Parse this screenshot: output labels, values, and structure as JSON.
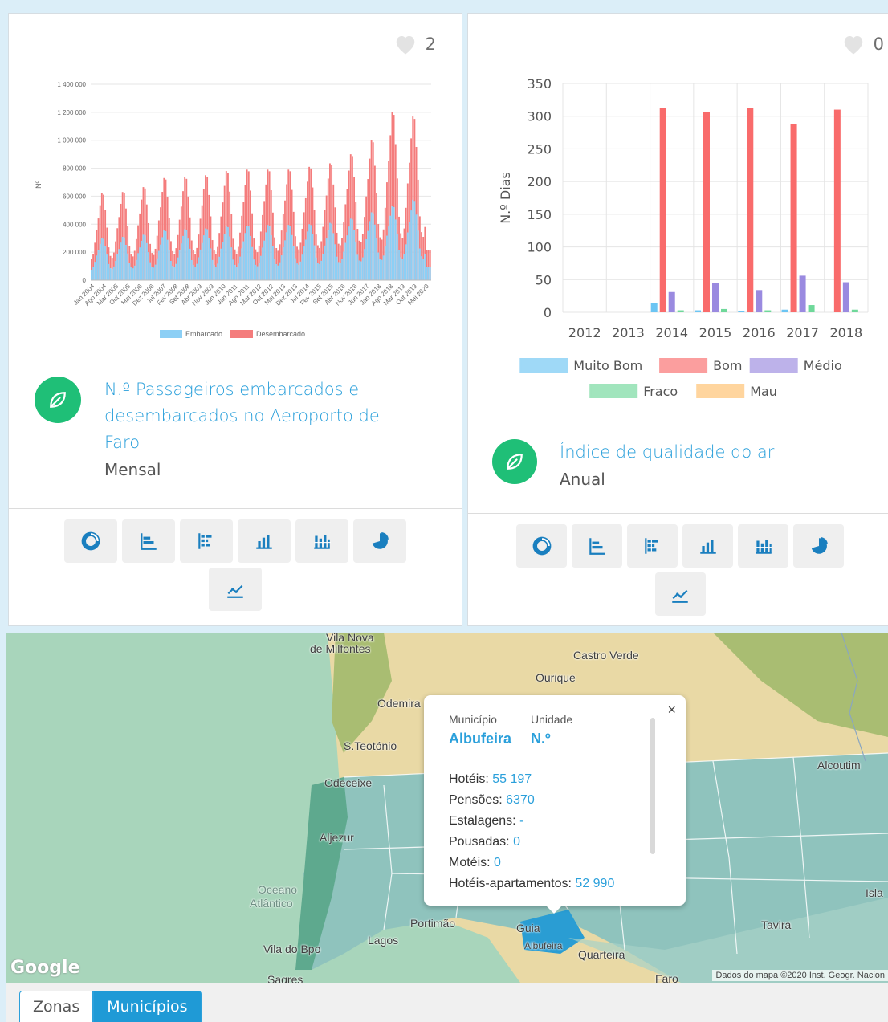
{
  "cards": [
    {
      "likes": "2",
      "title": "N.º Passageiros embarcados e desembarcados no Aeroporto de Faro",
      "title_lines": [
        "N.º Passageiros embarcados e",
        "desembarcados no Aeroporto de",
        "Faro"
      ],
      "periodicity": "Mensal"
    },
    {
      "likes": "0",
      "title": "Índice de qualidade do ar",
      "periodicity": "Anual"
    }
  ],
  "toolbar_icons": [
    "donut-chart-icon",
    "horizontal-bar-icon",
    "stacked-horizontal-bar-icon",
    "bar-chart-icon",
    "stacked-bar-chart-icon",
    "pie-chart-icon",
    "line-chart-icon"
  ],
  "chart_data": [
    {
      "type": "bar",
      "stacked": true,
      "title": "",
      "xlabel": "",
      "ylabel": "Nº",
      "ylim": [
        0,
        1400000
      ],
      "yticks": [
        "0",
        "200 000",
        "400 000",
        "600 000",
        "800 000",
        "1 000 000",
        "1 200 000",
        "1 400 000"
      ],
      "categories": [
        "Jan 2004",
        "Ago 2004",
        "Mar 2005",
        "Out 2005",
        "Mai 2006",
        "Dez 2006",
        "Jul 2007",
        "Fev 2008",
        "Set 2008",
        "Abr 2009",
        "Nov 2009",
        "Jun 2010",
        "Jan 2011",
        "Ago 2011",
        "Mar 2012",
        "Out 2012",
        "Mai 2013",
        "Dez 2013",
        "Jul 2014",
        "Fev 2015",
        "Set 2015",
        "Abr 2016",
        "Nov 2016",
        "Jun 2017",
        "Jan 2018",
        "Ago 2018",
        "Mar 2019",
        "Out 2019",
        "Mai 2020"
      ],
      "series": [
        {
          "name": "Embarcado",
          "color": "#8ccff5",
          "annual_peaks": [
            300000,
            310000,
            325000,
            355000,
            365000,
            370000,
            385000,
            390000,
            395000,
            395000,
            400000,
            410000,
            440000,
            485000,
            530000,
            575000,
            570000
          ],
          "annual_lows": [
            75000,
            80000,
            85000,
            90000,
            95000,
            95000,
            95000,
            95000,
            100000,
            105000,
            110000,
            115000,
            125000,
            135000,
            145000,
            150000,
            155000
          ]
        },
        {
          "name": "Desembarcado",
          "color": "#f47c7c",
          "annual_peaks": [
            620000,
            630000,
            665000,
            730000,
            735000,
            750000,
            780000,
            790000,
            790000,
            790000,
            810000,
            835000,
            900000,
            1000000,
            1200000,
            1170000,
            1190000
          ],
          "annual_lows": [
            150000,
            160000,
            170000,
            180000,
            185000,
            185000,
            190000,
            190000,
            200000,
            210000,
            220000,
            230000,
            250000,
            270000,
            290000,
            300000,
            310000
          ]
        }
      ],
      "legend": "bottom",
      "grid": true
    },
    {
      "type": "bar",
      "title": "",
      "xlabel": "",
      "ylabel": "N.º Dias",
      "ylim": [
        0,
        350
      ],
      "yticks": [
        "0",
        "50",
        "100",
        "150",
        "200",
        "250",
        "300",
        "350"
      ],
      "categories": [
        "2012",
        "2013",
        "2014",
        "2015",
        "2016",
        "2017",
        "2018"
      ],
      "series": [
        {
          "name": "Muito Bom",
          "color": "#6cc5f3",
          "values": [
            0,
            0,
            14,
            3,
            2,
            4,
            0
          ]
        },
        {
          "name": "Bom",
          "color": "#f96b6b",
          "values": [
            0,
            0,
            312,
            306,
            313,
            288,
            310
          ]
        },
        {
          "name": "Médio",
          "color": "#9a8ae0",
          "values": [
            0,
            0,
            31,
            45,
            34,
            56,
            46
          ]
        },
        {
          "name": "Fraco",
          "color": "#6fd89a",
          "values": [
            0,
            0,
            3,
            5,
            3,
            11,
            4
          ]
        },
        {
          "name": "Mau",
          "color": "#ffbf6b",
          "values": [
            0,
            0,
            0,
            0,
            0,
            0,
            0
          ]
        }
      ],
      "legend": "bottom",
      "grid": true
    }
  ],
  "map": {
    "places": [
      {
        "name": "Vila Nova",
        "pos": "a"
      },
      {
        "name": "de Milfontes",
        "pos": "b"
      },
      {
        "name": "Castro Verde",
        "pos": "c"
      },
      {
        "name": "Ourique",
        "pos": "d"
      },
      {
        "name": "Odemira",
        "pos": "e"
      },
      {
        "name": "S.Teotónio",
        "pos": "f"
      },
      {
        "name": "Odeceixe",
        "pos": "g"
      },
      {
        "name": "Aljezur",
        "pos": "h"
      },
      {
        "name": "Oceano",
        "pos": "i"
      },
      {
        "name": "Atlântico",
        "pos": "j"
      },
      {
        "name": "Portimão",
        "pos": "k"
      },
      {
        "name": "Lagos",
        "pos": "l"
      },
      {
        "name": "Vila do Bpo",
        "pos": "m"
      },
      {
        "name": "Sagres",
        "pos": "n"
      },
      {
        "name": "Guia",
        "pos": "o"
      },
      {
        "name": "Albufeira",
        "pos": "p"
      },
      {
        "name": "Quarteira",
        "pos": "q"
      },
      {
        "name": "Faro",
        "pos": "r"
      },
      {
        "name": "Tavira",
        "pos": "s"
      },
      {
        "name": "Alcoutim",
        "pos": "t"
      },
      {
        "name": "Isla",
        "pos": "u"
      }
    ],
    "logo": "Google",
    "attribution": "Dados do mapa ©2020 Inst. Geogr. Nacion",
    "popup": {
      "close": "×",
      "municipio_label": "Município",
      "municipio_value": "Albufeira",
      "unidade_label": "Unidade",
      "unidade_value": "N.º",
      "rows": [
        {
          "label": "Hotéis: ",
          "value": "55 197"
        },
        {
          "label": "Pensões: ",
          "value": "6370"
        },
        {
          "label": "Estalagens: ",
          "value": "-"
        },
        {
          "label": "Pousadas: ",
          "value": "0"
        },
        {
          "label": "Motéis: ",
          "value": "0"
        },
        {
          "label": "Hotéis-apartamentos: ",
          "value": "52 990"
        }
      ]
    }
  },
  "tabs": {
    "zonas": "Zonas",
    "municipios": "Municípios"
  },
  "colors": {
    "accent": "#2ba0db",
    "badge": "#1fbf77",
    "heart": "#e3e3e3"
  }
}
